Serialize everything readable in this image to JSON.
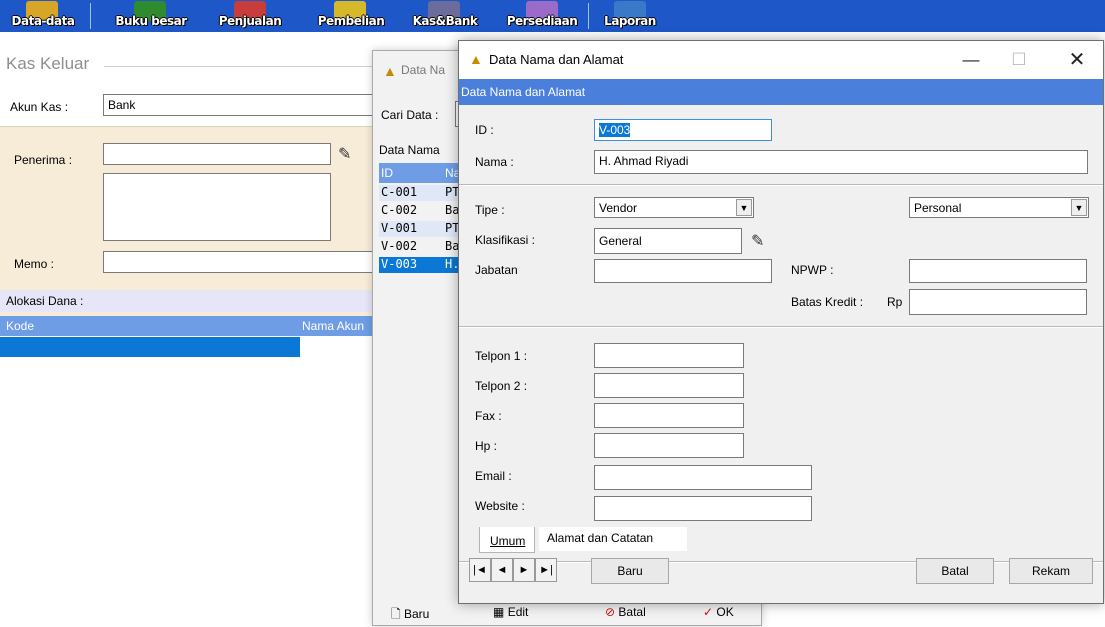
{
  "toolbar": {
    "items": [
      {
        "label": "Data-data",
        "icon": "data-icon",
        "color": "#d8a624"
      },
      {
        "label": "Buku besar",
        "icon": "book-icon",
        "color": "#2e8b2e"
      },
      {
        "label": "Penjualan",
        "icon": "sales-icon",
        "color": "#c83c3c"
      },
      {
        "label": "Pembelian",
        "icon": "purchase-icon",
        "color": "#d6b92a"
      },
      {
        "label": "Kas&Bank",
        "icon": "bank-icon",
        "color": "#6b6b9c"
      },
      {
        "label": "Persediaan",
        "icon": "inventory-icon",
        "color": "#9a6bc8"
      },
      {
        "label": "Laporan",
        "icon": "report-icon",
        "color": "#3a78c8"
      }
    ]
  },
  "kas_keluar": {
    "title": "Kas Keluar",
    "akun_kas_label": "Akun Kas :",
    "akun_kas_value": "Bank",
    "penerima_label": "Penerima :",
    "penerima_value": "",
    "memo_label": "Memo :",
    "memo_value": "",
    "alokasi_label": "Alokasi Dana :",
    "columns": [
      "Kode",
      "Nama Akun"
    ]
  },
  "list_window": {
    "title": "Data Na",
    "cari_data_label": "Cari Data :",
    "header": "Data Nama",
    "columns": [
      "ID",
      "Na"
    ],
    "rows": [
      {
        "id": "C-001",
        "name": "PT"
      },
      {
        "id": "C-002",
        "name": "Ba"
      },
      {
        "id": "V-001",
        "name": "PT"
      },
      {
        "id": "V-002",
        "name": "Ba"
      },
      {
        "id": "V-003",
        "name": "H."
      }
    ],
    "selected_index": 4,
    "buttons": {
      "baru": "Baru",
      "edit": "Edit",
      "batal": "Batal",
      "ok": "OK"
    }
  },
  "dialog": {
    "title": "Data Nama dan Alamat",
    "subtitle": "Data Nama dan Alamat",
    "id_label": "ID :",
    "id_value": "V-003",
    "nama_label": "Nama :",
    "nama_value": "H. Ahmad Riyadi",
    "tipe_label": "Tipe :",
    "tipe_value": "Vendor",
    "tipe2_value": "Personal",
    "klasifikasi_label": "Klasifikasi :",
    "klasifikasi_value": "General",
    "jabatan_label": "Jabatan",
    "jabatan_value": "",
    "npwp_label": "NPWP :",
    "npwp_value": "",
    "batas_kredit_label": "Batas Kredit :",
    "rp_label": "Rp",
    "batas_kredit_value": "",
    "telpon1_label": "Telpon 1 :",
    "telpon2_label": "Telpon 2 :",
    "fax_label": "Fax :",
    "hp_label": "Hp :",
    "email_label": "Email :",
    "website_label": "Website :",
    "tabs": [
      "Umum",
      "Alamat dan Catatan"
    ],
    "nav": [
      "|◄",
      "◄",
      "►",
      "►|"
    ],
    "baru_label": "Baru",
    "batal_label": "Batal",
    "rekam_label": "Rekam"
  }
}
